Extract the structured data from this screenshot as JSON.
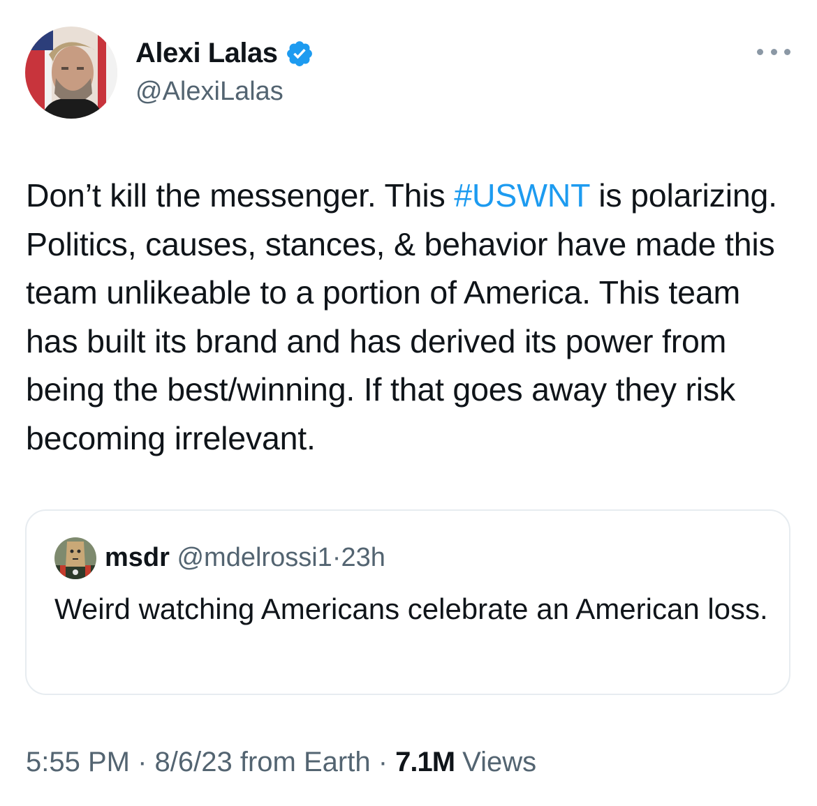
{
  "author": {
    "name": "Alexi Lalas",
    "handle": "@AlexiLalas",
    "avatar_icon": "profile-photo-flag-background",
    "verified_icon": "verified-badge-icon",
    "verified_color": "#1d9bf0"
  },
  "tweet": {
    "text_before": "Don’t kill the messenger. This ",
    "hashtag": "#USWNT",
    "text_after": " is polarizing. Politics, causes, stances, & behavior have made this team unlikeable to a portion of America. This team has built its brand and has derived its power from being the best/winning. If that goes away they risk becoming irrelevant.",
    "hashtag_color": "#1d9bf0"
  },
  "quote": {
    "name": "msdr",
    "handle": "@mdelrossi1",
    "separator": "·",
    "time": "23h",
    "text": "Weird watching Americans celebrate an American loss.",
    "avatar_icon": "paper-bag-head-avatar"
  },
  "footer": {
    "time": "5:55 PM",
    "sep1": " · ",
    "date": "8/6/23",
    "source": " from Earth",
    "sep2": " · ",
    "views_count": "7.1M",
    "views_label": " Views"
  },
  "more_icon": "more-options-icon"
}
